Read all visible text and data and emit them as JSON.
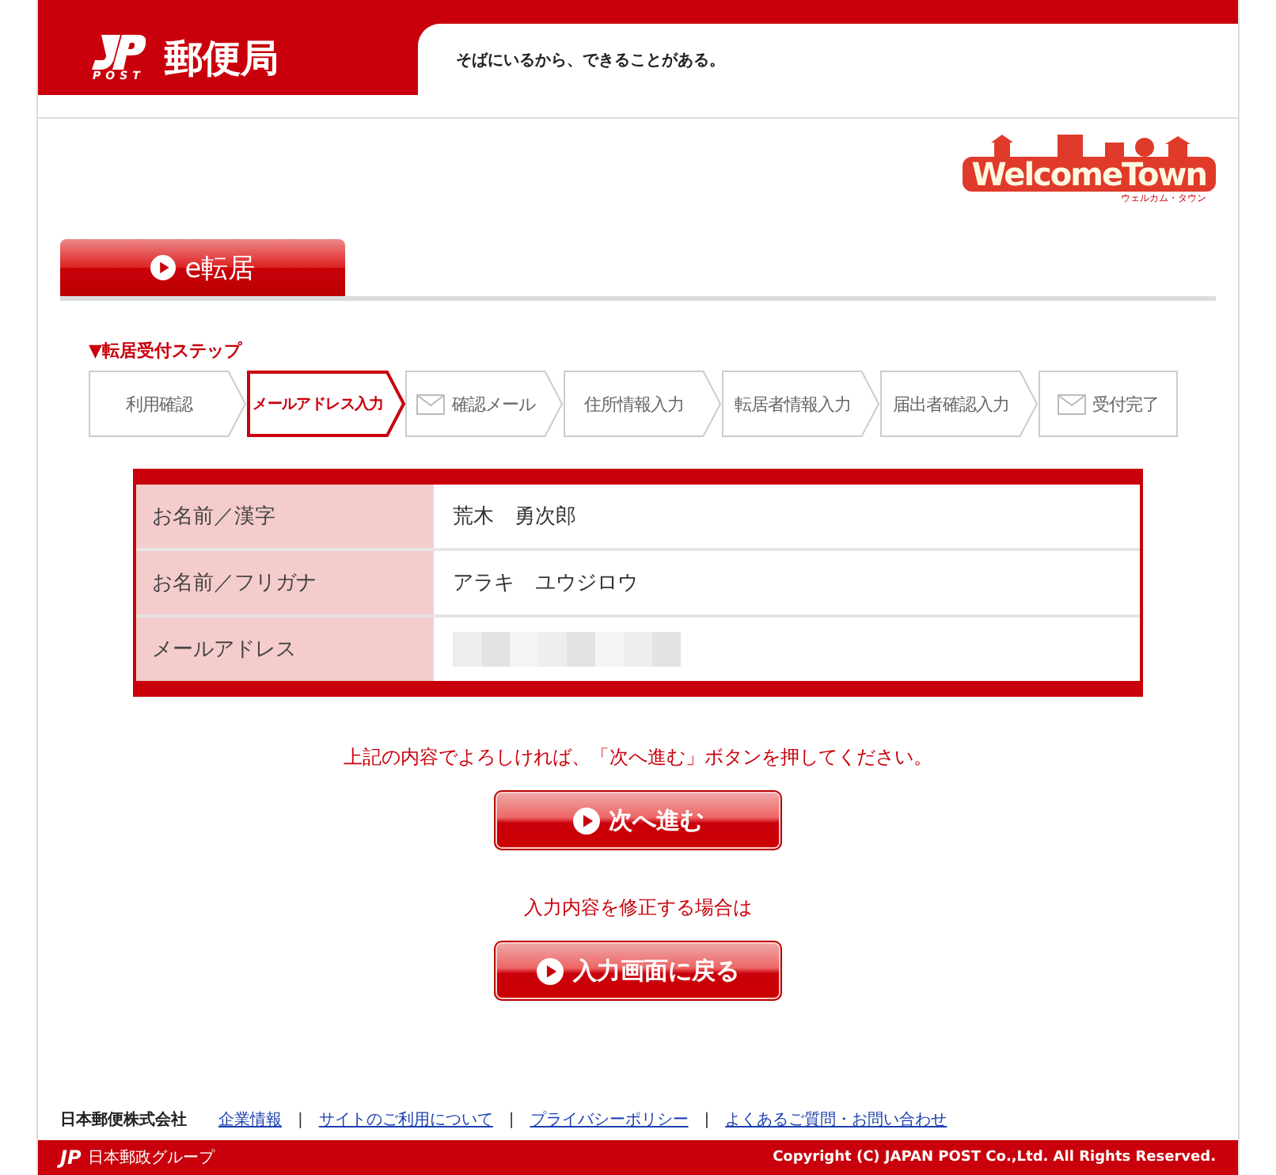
{
  "header": {
    "logo_mark": "POST",
    "logo_text": "郵便局",
    "tagline": "そばにいるから、できることがある。"
  },
  "campaign_logo": {
    "title": "WelcomeTown",
    "subtitle": "ウェルカム・タウン"
  },
  "service_tab": {
    "label": "e転居"
  },
  "steps": {
    "title": "▼転居受付ステップ",
    "items": [
      {
        "label": "利用確認",
        "kind": "plain",
        "selected": false
      },
      {
        "label": "メールアドレス入力",
        "kind": "plain",
        "selected": true
      },
      {
        "label": "確認メール",
        "kind": "mail",
        "selected": false
      },
      {
        "label": "住所情報入力",
        "kind": "plain",
        "selected": false
      },
      {
        "label": "転居者情報入力",
        "kind": "plain",
        "selected": false
      },
      {
        "label": "届出者確認入力",
        "kind": "plain",
        "selected": false
      },
      {
        "label": "受付完了",
        "kind": "mail",
        "selected": false
      }
    ]
  },
  "table": {
    "rows": [
      {
        "label": "お名前／漢字",
        "value": "荒木　勇次郎",
        "kind": "text"
      },
      {
        "label": "お名前／フリガナ",
        "value": "アラキ　ユウジロウ",
        "kind": "text"
      },
      {
        "label": "メールアドレス",
        "kind": "redacted"
      }
    ]
  },
  "confirm_message": "上記の内容でよろしければ、「次へ進む」ボタンを押してください。",
  "next_button": "次へ進む",
  "edit_message": "入力内容を修正する場合は",
  "back_button": "入力画面に戻る",
  "footer": {
    "company": "日本郵便株式会社",
    "links": [
      "企業情報",
      "サイトのご利用について",
      "プライバシーポリシー",
      "よくあるご質問・お問い合わせ"
    ],
    "separator": "|",
    "group": "日本郵政グループ",
    "group_mark": "JP",
    "copyright": "Copyright (C) JAPAN POST Co.,Ltd.  All Rights Reserved."
  }
}
